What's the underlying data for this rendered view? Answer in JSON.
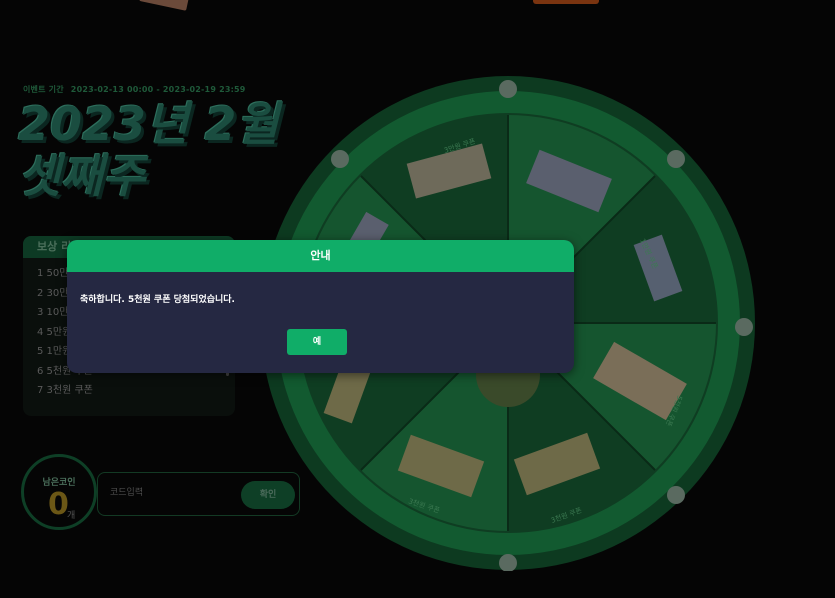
{
  "event": {
    "period_label": "이벤트 기간",
    "period_value": "2023-02-13 00:00 - 2023-02-19 23:59"
  },
  "title": {
    "line1": "2023년 2월",
    "line2": "셋째주"
  },
  "rewards": {
    "header": "보상 리",
    "items": [
      "1 50만",
      "2 30만",
      "3 10만",
      "4 5만원",
      "5 1만원",
      "6 5천원 쿠폰",
      "7 3천원 쿠폰"
    ]
  },
  "coins": {
    "label": "남은코인",
    "count": "0",
    "unit": "개"
  },
  "code": {
    "placeholder": "코드입력",
    "confirm_label": "확인"
  },
  "wheel": {
    "segment_labels": [
      "3만원 쿠폰",
      "1만원 쿠폰",
      "5천원 쿠폰",
      "3천원 쿠폰",
      "3천원 쿠폰"
    ]
  },
  "modal": {
    "title": "안내",
    "message": "축하합니다. 5천원 쿠폰 당첨되었습니다.",
    "ok_label": "예"
  },
  "colors": {
    "accent": "#10ad68",
    "modal_bg": "#252842",
    "wheel_dark": "#0f3d22",
    "wheel_light": "#15552f"
  }
}
